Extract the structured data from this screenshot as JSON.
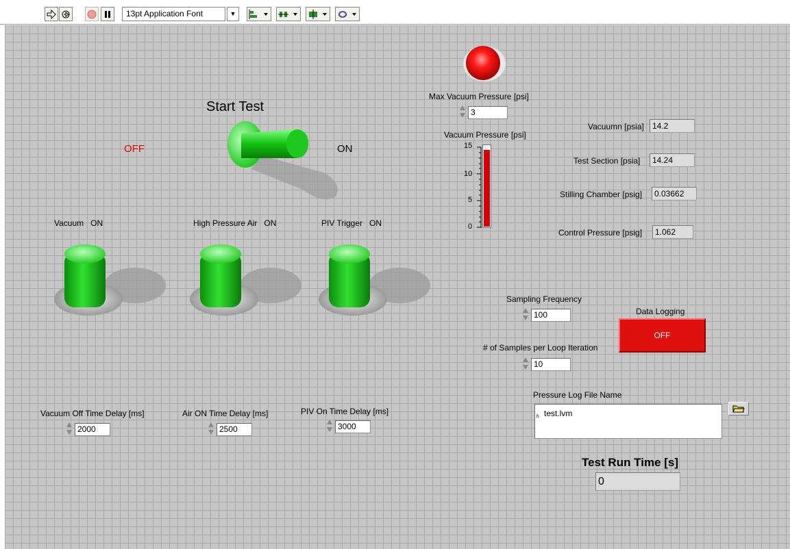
{
  "toolbar": {
    "font_ring": "13pt Application Font",
    "buttons": [
      "run-arrow-icon",
      "run-continuously-icon",
      "abort-icon",
      "pause-icon",
      "align-icon",
      "distribute-icon",
      "resize-icon",
      "reorder-icon"
    ]
  },
  "controls": {
    "start_test": {
      "label": "Start Test",
      "off_text": "OFF",
      "on_text": "ON",
      "state": "on"
    },
    "vacuum": {
      "label": "Vacuum",
      "state_text": "ON"
    },
    "high_pressure_air": {
      "label": "High Pressure Air",
      "state_text": "ON"
    },
    "piv_trigger": {
      "label": "PIV Trigger",
      "state_text": "ON"
    },
    "vacuum_off_delay": {
      "label": "Vacuum Off Time Delay [ms]",
      "value": "2000"
    },
    "air_on_delay": {
      "label": "Air ON Time Delay [ms]",
      "value": "2500"
    },
    "piv_on_delay": {
      "label": "PIV On Time Delay [ms]",
      "value": "3000"
    },
    "max_vacuum_pressure": {
      "label": "Max Vacuum Pressure [psi]",
      "value": "3"
    },
    "sampling_frequency": {
      "label": "Sampling Frequency",
      "value": "100"
    },
    "samples_per_loop": {
      "label": "# of Samples per Loop Iteration",
      "value": "10"
    },
    "data_logging": {
      "label": "Data Logging",
      "button_text": "OFF"
    },
    "log_file": {
      "label": "Pressure Log File Name",
      "path": "test.lvm"
    }
  },
  "indicators": {
    "vacuum_pressure_bar": {
      "label": "Vacuum Pressure [psi]",
      "ticks": [
        "15",
        "10",
        "5",
        "0"
      ],
      "min": 0,
      "max": 15,
      "value": 14.2
    },
    "readouts": [
      {
        "label": "Vacuumn [psia]",
        "value": "14.2"
      },
      {
        "label": "Test Section [psia]",
        "value": "14.24"
      },
      {
        "label": "Stilling Chamber [psig]",
        "value": "0.03662"
      },
      {
        "label": "Control Pressure [psig]",
        "value": "1.062"
      }
    ],
    "test_run_time": {
      "label": "Test Run Time [s]",
      "value": "0"
    },
    "alarm_led": {
      "state": "on"
    }
  },
  "colors": {
    "panel": "#c6c6c6",
    "grid": "#a8a8a8",
    "green": "#1fd11f",
    "red": "#e01010",
    "led": "#ff1a1a"
  }
}
